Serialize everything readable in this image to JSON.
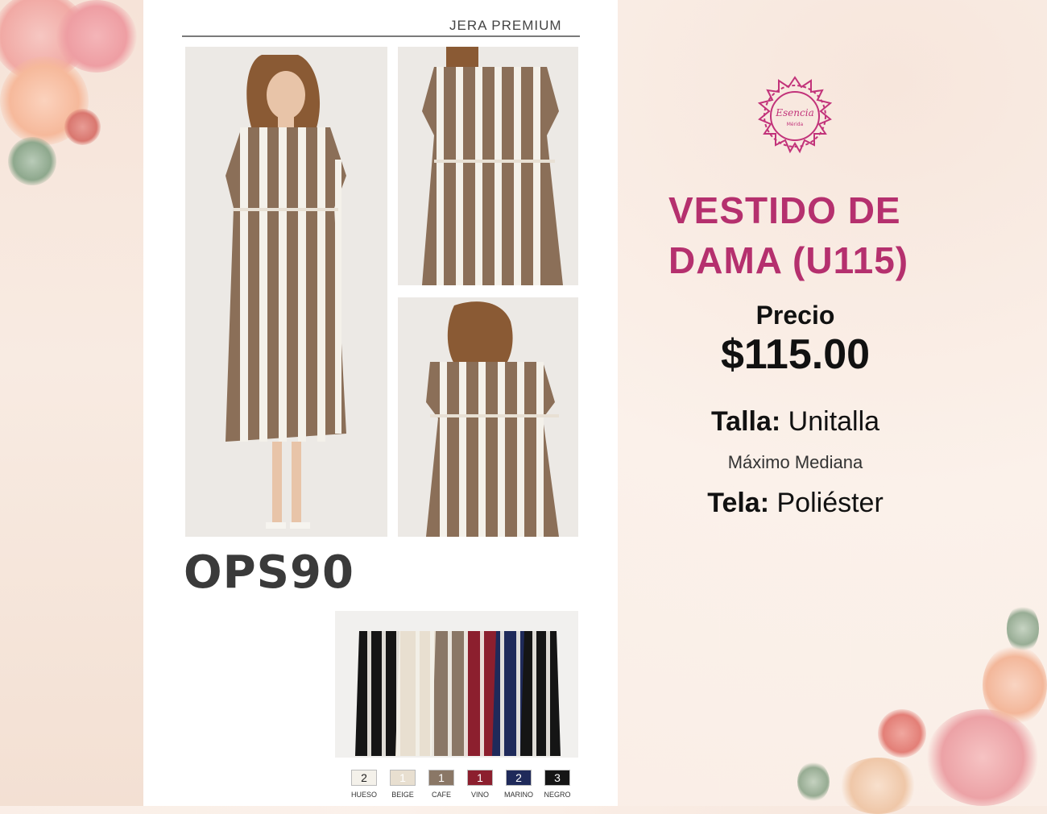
{
  "catalog": {
    "brand": "JERA PREMIUM",
    "model_code": "OPS90",
    "color_options": [
      {
        "count": "2",
        "name": "HUESO",
        "color": "#f4f1ea",
        "text_color": "#222"
      },
      {
        "count": "1",
        "name": "BEIGE",
        "color": "#e8dfd0",
        "text_color": "#fff"
      },
      {
        "count": "1",
        "name": "CAFE",
        "color": "#8a7766",
        "text_color": "#fff"
      },
      {
        "count": "1",
        "name": "VINO",
        "color": "#8c1f2e",
        "text_color": "#fff"
      },
      {
        "count": "2",
        "name": "MARINO",
        "color": "#1f2a5a",
        "text_color": "#fff"
      },
      {
        "count": "3",
        "name": "NEGRO",
        "color": "#151515",
        "text_color": "#fff"
      }
    ]
  },
  "logo": {
    "line1": "Esencia",
    "line2": "Mérida"
  },
  "product": {
    "title": "VESTIDO DE DAMA (U115)",
    "price_label": "Precio",
    "price": "$115.00",
    "size_label": "Talla:",
    "size_value": "Unitalla",
    "size_note": "Máximo Mediana",
    "fabric_label": "Tela:",
    "fabric_value": "Poliéster"
  },
  "colors": {
    "accent": "#b5306e",
    "dress_stripe": "#8b6f58"
  }
}
